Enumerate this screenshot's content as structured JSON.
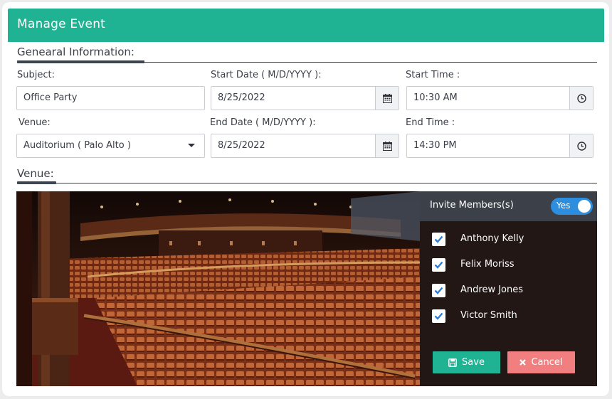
{
  "header": {
    "title": "Manage Event"
  },
  "general": {
    "section_title": "Genearal Information:"
  },
  "fields": {
    "subject": {
      "label": "Subject:",
      "value": "Office Party"
    },
    "start_date": {
      "label": "Start Date ( M/D/YYYY ):",
      "value": "8/25/2022"
    },
    "start_time": {
      "label": "Start Time :",
      "value": "10:30 AM"
    },
    "venue": {
      "label": "Venue:",
      "value": "Auditorium ( Palo Alto )"
    },
    "end_date": {
      "label": "End Date ( M/D/YYYY ):",
      "value": "8/25/2022"
    },
    "end_time": {
      "label": "End Time :",
      "value": "14:30 PM"
    }
  },
  "venue_section": {
    "title": "Venue:"
  },
  "members": {
    "title": "Invite Members(s)",
    "toggle_label": "Yes",
    "toggle_on": true,
    "list": [
      {
        "name": "Anthony Kelly",
        "checked": true
      },
      {
        "name": "Felix Moriss",
        "checked": true
      },
      {
        "name": "Andrew Jones",
        "checked": true
      },
      {
        "name": "Victor Smith",
        "checked": true
      }
    ]
  },
  "actions": {
    "save_label": "Save",
    "cancel_label": "Cancel"
  },
  "colors": {
    "accent": "#1fb293",
    "danger": "#f27f7f",
    "toggle": "#2d8ee0",
    "text": "#3b3f48"
  }
}
